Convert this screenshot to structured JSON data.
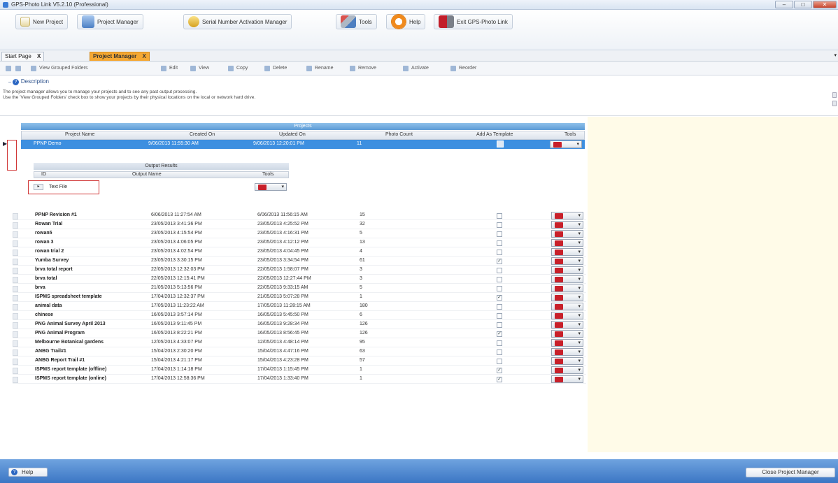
{
  "window": {
    "title": "GPS-Photo Link V5.2.10 (Professional)",
    "minimize": "–",
    "maximize": "□",
    "close": "✕"
  },
  "toolbar": {
    "new_project": "New Project",
    "project_manager": "Project Manager",
    "serial_manager": "Serial Number Activation Manager",
    "tools": "Tools",
    "help": "Help",
    "exit": "Exit GPS-Photo Link"
  },
  "tabs": [
    {
      "label": "Start Page",
      "close": "X"
    },
    {
      "label": "Project Manager",
      "close": "X"
    }
  ],
  "subtoolbar": {
    "view_grouped": "View Grouped Folders",
    "edit": "Edit",
    "view": "View",
    "copy": "Copy",
    "delete": "Delete",
    "rename": "Rename",
    "remove": "Remove",
    "activate": "Activate",
    "reorder": "Reorder"
  },
  "description": {
    "header": "Description",
    "line1": "The project manager allows you to manage your projects and to see any past output processing.",
    "line2": "Use the 'View Grouped Folders' check box to show your projects by their physical locations on the local or network hard drive."
  },
  "projects_grid": {
    "title": "Projects",
    "columns": [
      "Project Name",
      "Created On",
      "Updated On",
      "Photo Count",
      "Add As Template",
      "Tools"
    ],
    "selected": {
      "name": "PPNP Demo",
      "created": "9/06/2013 11:55:30 AM",
      "updated": "9/06/2013 12:20:01 PM",
      "count": "11"
    }
  },
  "output_results": {
    "title": "Output Results",
    "columns": [
      "ID",
      "Output Name",
      "Tools"
    ],
    "row": {
      "name": "Text File"
    }
  },
  "rows": [
    {
      "name": "PPNP Revision #1",
      "created": "6/06/2013 11:27:54 AM",
      "updated": "6/06/2013 11:56:15 AM",
      "count": "15",
      "tpl": ""
    },
    {
      "name": "Rowan Trial",
      "created": "23/05/2013 3:41:36 PM",
      "updated": "23/05/2013 4:25:52 PM",
      "count": "32",
      "tpl": ""
    },
    {
      "name": "rowan5",
      "created": "23/05/2013 4:15:54 PM",
      "updated": "23/05/2013 4:16:31 PM",
      "count": "5",
      "tpl": ""
    },
    {
      "name": "rowan 3",
      "created": "23/05/2013 4:06:05 PM",
      "updated": "23/05/2013 4:12:12 PM",
      "count": "13",
      "tpl": ""
    },
    {
      "name": "rowan trial 2",
      "created": "23/05/2013 4:02:54 PM",
      "updated": "23/05/2013 4:04:45 PM",
      "count": "4",
      "tpl": ""
    },
    {
      "name": "Yumba Survey",
      "created": "23/05/2013 3:30:15 PM",
      "updated": "23/05/2013 3:34:54 PM",
      "count": "61",
      "tpl": "✓"
    },
    {
      "name": "brva total report",
      "created": "22/05/2013 12:32:03 PM",
      "updated": "22/05/2013 1:58:07 PM",
      "count": "3",
      "tpl": ""
    },
    {
      "name": "brva total",
      "created": "22/05/2013 12:15:41 PM",
      "updated": "22/05/2013 12:27:44 PM",
      "count": "3",
      "tpl": ""
    },
    {
      "name": "brva",
      "created": "21/05/2013 5:13:56 PM",
      "updated": "22/05/2013 9:33:15 AM",
      "count": "5",
      "tpl": ""
    },
    {
      "name": "ISPMS spreadsheet template",
      "created": "17/04/2013 12:32:37 PM",
      "updated": "21/05/2013 5:07:28 PM",
      "count": "1",
      "tpl": "✓"
    },
    {
      "name": "animal data",
      "created": "17/05/2013 11:23:22 AM",
      "updated": "17/05/2013 11:28:15 AM",
      "count": "180",
      "tpl": ""
    },
    {
      "name": "chinese",
      "created": "16/05/2013 3:57:14 PM",
      "updated": "16/05/2013 5:45:50 PM",
      "count": "6",
      "tpl": ""
    },
    {
      "name": "PNG Animal Survey April 2013",
      "created": "16/05/2013 9:11:45 PM",
      "updated": "16/05/2013 9:28:34 PM",
      "count": "126",
      "tpl": ""
    },
    {
      "name": "PNG Animal Program",
      "created": "16/05/2013 8:22:21 PM",
      "updated": "16/05/2013 8:56:45 PM",
      "count": "126",
      "tpl": "✓"
    },
    {
      "name": "Melbourne Botanical gardens",
      "created": "12/05/2013 4:33:07 PM",
      "updated": "12/05/2013 4:48:14 PM",
      "count": "95",
      "tpl": ""
    },
    {
      "name": "ANBG Trail#1",
      "created": "15/04/2013 2:30:20 PM",
      "updated": "15/04/2013 4:47:16 PM",
      "count": "63",
      "tpl": ""
    },
    {
      "name": "ANBG Report Trail #1",
      "created": "15/04/2013 4:21:17 PM",
      "updated": "15/04/2013 4:23:28 PM",
      "count": "57",
      "tpl": ""
    },
    {
      "name": "ISPMS report template (offline)",
      "created": "17/04/2013 1:14:18 PM",
      "updated": "17/04/2013 1:15:45 PM",
      "count": "1",
      "tpl": "✓"
    },
    {
      "name": "ISPMS report template (online)",
      "created": "17/04/2013 12:58:36 PM",
      "updated": "17/04/2013 1:33:40 PM",
      "count": "1",
      "tpl": "✓"
    }
  ],
  "statusbar": {
    "help": "Help",
    "close_pm": "Close Project Manager"
  },
  "colors": {
    "selected_row": "#3d8fe0",
    "active_tab": "#f5a833",
    "status_bar": "#3b76c4",
    "right_pane": "#fffbe8"
  }
}
